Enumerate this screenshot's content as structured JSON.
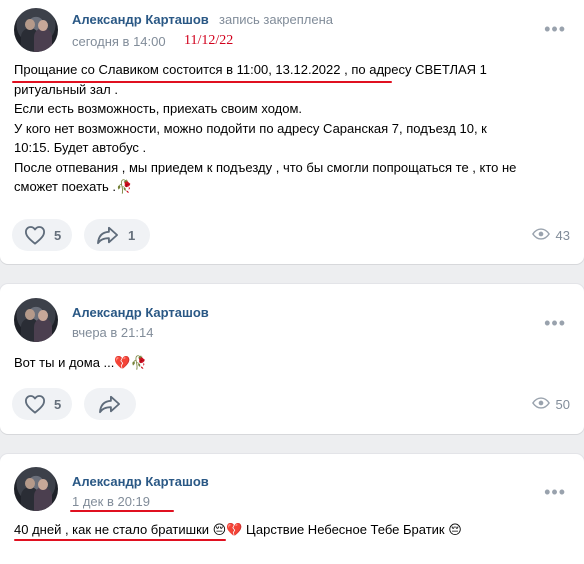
{
  "posts": [
    {
      "author": "Александр Карташов",
      "pin_note": "запись закреплена",
      "date": "сегодня в 14:00",
      "handwritten_date": "11/12/22",
      "text": [
        "Прощание со Славиком состоится в 11:00, 13.12.2022 , по адресу СВЕТЛАЯ 1",
        "ритуальный зал .",
        "Если есть возможность, приехать своим ходом.",
        "У кого нет возможности, можно подойти по адресу Саранская 7, подъезд 10, к",
        "10:15. Будет автобус .",
        "После отпевания , мы приедем к подъезду , что бы смогли попрощаться те , кто не",
        "сможет поехать .🥀"
      ],
      "likes": "5",
      "shares": "1",
      "views": "43"
    },
    {
      "author": "Александр Карташов",
      "date": "вчера в 21:14",
      "text": "Вот ты и дома ...💔🥀",
      "likes": "5",
      "views": "50"
    },
    {
      "author": "Александр Карташов",
      "date": "1 дек в 20:19",
      "text": "40 дней , как не стало братишки 😔💔 Царствие Небесное Тебе Братик 😔"
    }
  ],
  "icons": {
    "more": "more-dots-icon",
    "like": "heart-icon",
    "share": "share-arrow-icon",
    "views": "eye-icon"
  },
  "colors": {
    "link": "#2a5885",
    "secondary": "#818c99",
    "annotation": "#e01020"
  }
}
